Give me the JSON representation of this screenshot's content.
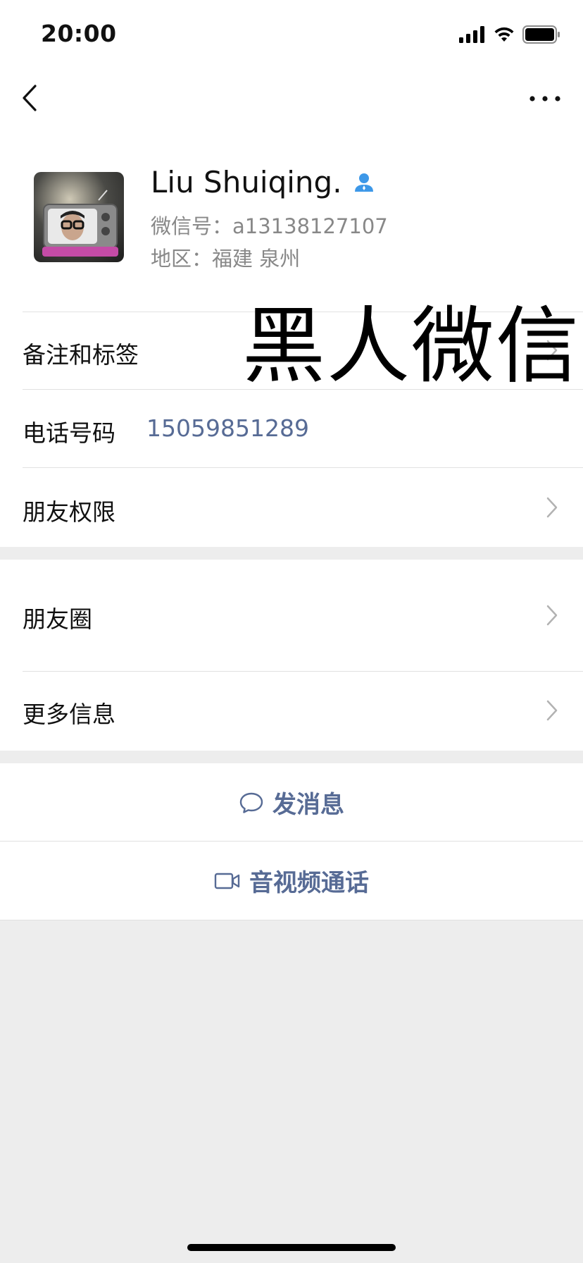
{
  "status_bar": {
    "time": "20:00"
  },
  "profile": {
    "name": "Liu Shuiqing.",
    "wechat_id": "微信号：a13138127107",
    "region": "地区：福建 泉州"
  },
  "overlay_text": "黑人微信",
  "rows": {
    "remarks": {
      "label": "备注和标签"
    },
    "phone": {
      "label": "电话号码",
      "value": "15059851289"
    },
    "permissions": {
      "label": "朋友权限"
    },
    "moments": {
      "label": "朋友圈"
    },
    "more_info": {
      "label": "更多信息"
    }
  },
  "actions": {
    "message": {
      "label": "发消息",
      "icon": "chat-bubble-icon"
    },
    "call": {
      "label": "音视频通话",
      "icon": "video-camera-icon"
    }
  },
  "colors": {
    "link": "#576b95",
    "background": "#ededed",
    "badge": "#3d98e8"
  }
}
